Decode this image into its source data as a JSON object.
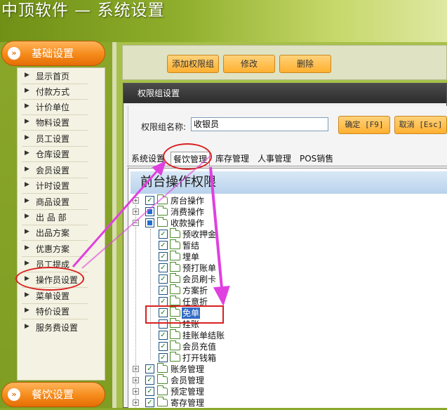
{
  "app": {
    "title": "中顶软件 — 系统设置"
  },
  "sidebar": {
    "group_basic": "基础设置",
    "group_dining": "餐饮设置",
    "items": [
      {
        "label": "显示首页"
      },
      {
        "label": "付款方式"
      },
      {
        "label": "计价单位"
      },
      {
        "label": "物料设置"
      },
      {
        "label": "员工设置"
      },
      {
        "label": "仓库设置"
      },
      {
        "label": "会员设置"
      },
      {
        "label": "计时设置"
      },
      {
        "label": "商品设置"
      },
      {
        "label": "出 品 部"
      },
      {
        "label": "出品方案"
      },
      {
        "label": "优惠方案"
      },
      {
        "label": "员工提成"
      },
      {
        "label": "操作员设置"
      },
      {
        "label": "菜单设置"
      },
      {
        "label": "特价设置"
      },
      {
        "label": "服务费设置"
      }
    ]
  },
  "toolbar": {
    "add_label": "添加权限组",
    "edit_label": "修改",
    "delete_label": "删除"
  },
  "dialog": {
    "title": "权限组设置",
    "name_label": "权限组名称:",
    "name_value": "收银员",
    "confirm_label": "确定 [F9]",
    "cancel_label": "取消 [Esc]",
    "tabs": [
      {
        "label": "系统设置"
      },
      {
        "label": "餐饮管理"
      },
      {
        "label": "库存管理"
      },
      {
        "label": "人事管理"
      },
      {
        "label": "POS销售"
      }
    ],
    "active_tab": "餐饮管理",
    "section_title": "前台操作权限",
    "tree": [
      {
        "label": "房台操作",
        "checked": true
      },
      {
        "label": "消费操作",
        "checked": "partial"
      },
      {
        "label": "收款操作",
        "checked": "partial",
        "children": [
          {
            "label": "预收押金",
            "checked": true
          },
          {
            "label": "暂结",
            "checked": true
          },
          {
            "label": "埋单",
            "checked": true
          },
          {
            "label": "预打账单",
            "checked": true
          },
          {
            "label": "会员刷卡",
            "checked": true
          },
          {
            "label": "方案折",
            "checked": true
          },
          {
            "label": "任意折",
            "checked": true
          },
          {
            "label": "免单",
            "checked": true,
            "selected": true
          },
          {
            "label": "挂账",
            "checked": false
          },
          {
            "label": "挂账单结账",
            "checked": true
          },
          {
            "label": "会员充值",
            "checked": true
          },
          {
            "label": "打开钱箱",
            "checked": true
          }
        ]
      },
      {
        "label": "账务管理",
        "checked": true
      },
      {
        "label": "会员管理",
        "checked": true
      },
      {
        "label": "预定管理",
        "checked": true
      },
      {
        "label": "寄存管理",
        "checked": true
      }
    ]
  },
  "colors": {
    "highlight": "#d92020",
    "annotation_arrow": "#e040e0",
    "accent_orange": "#f58a1a"
  }
}
